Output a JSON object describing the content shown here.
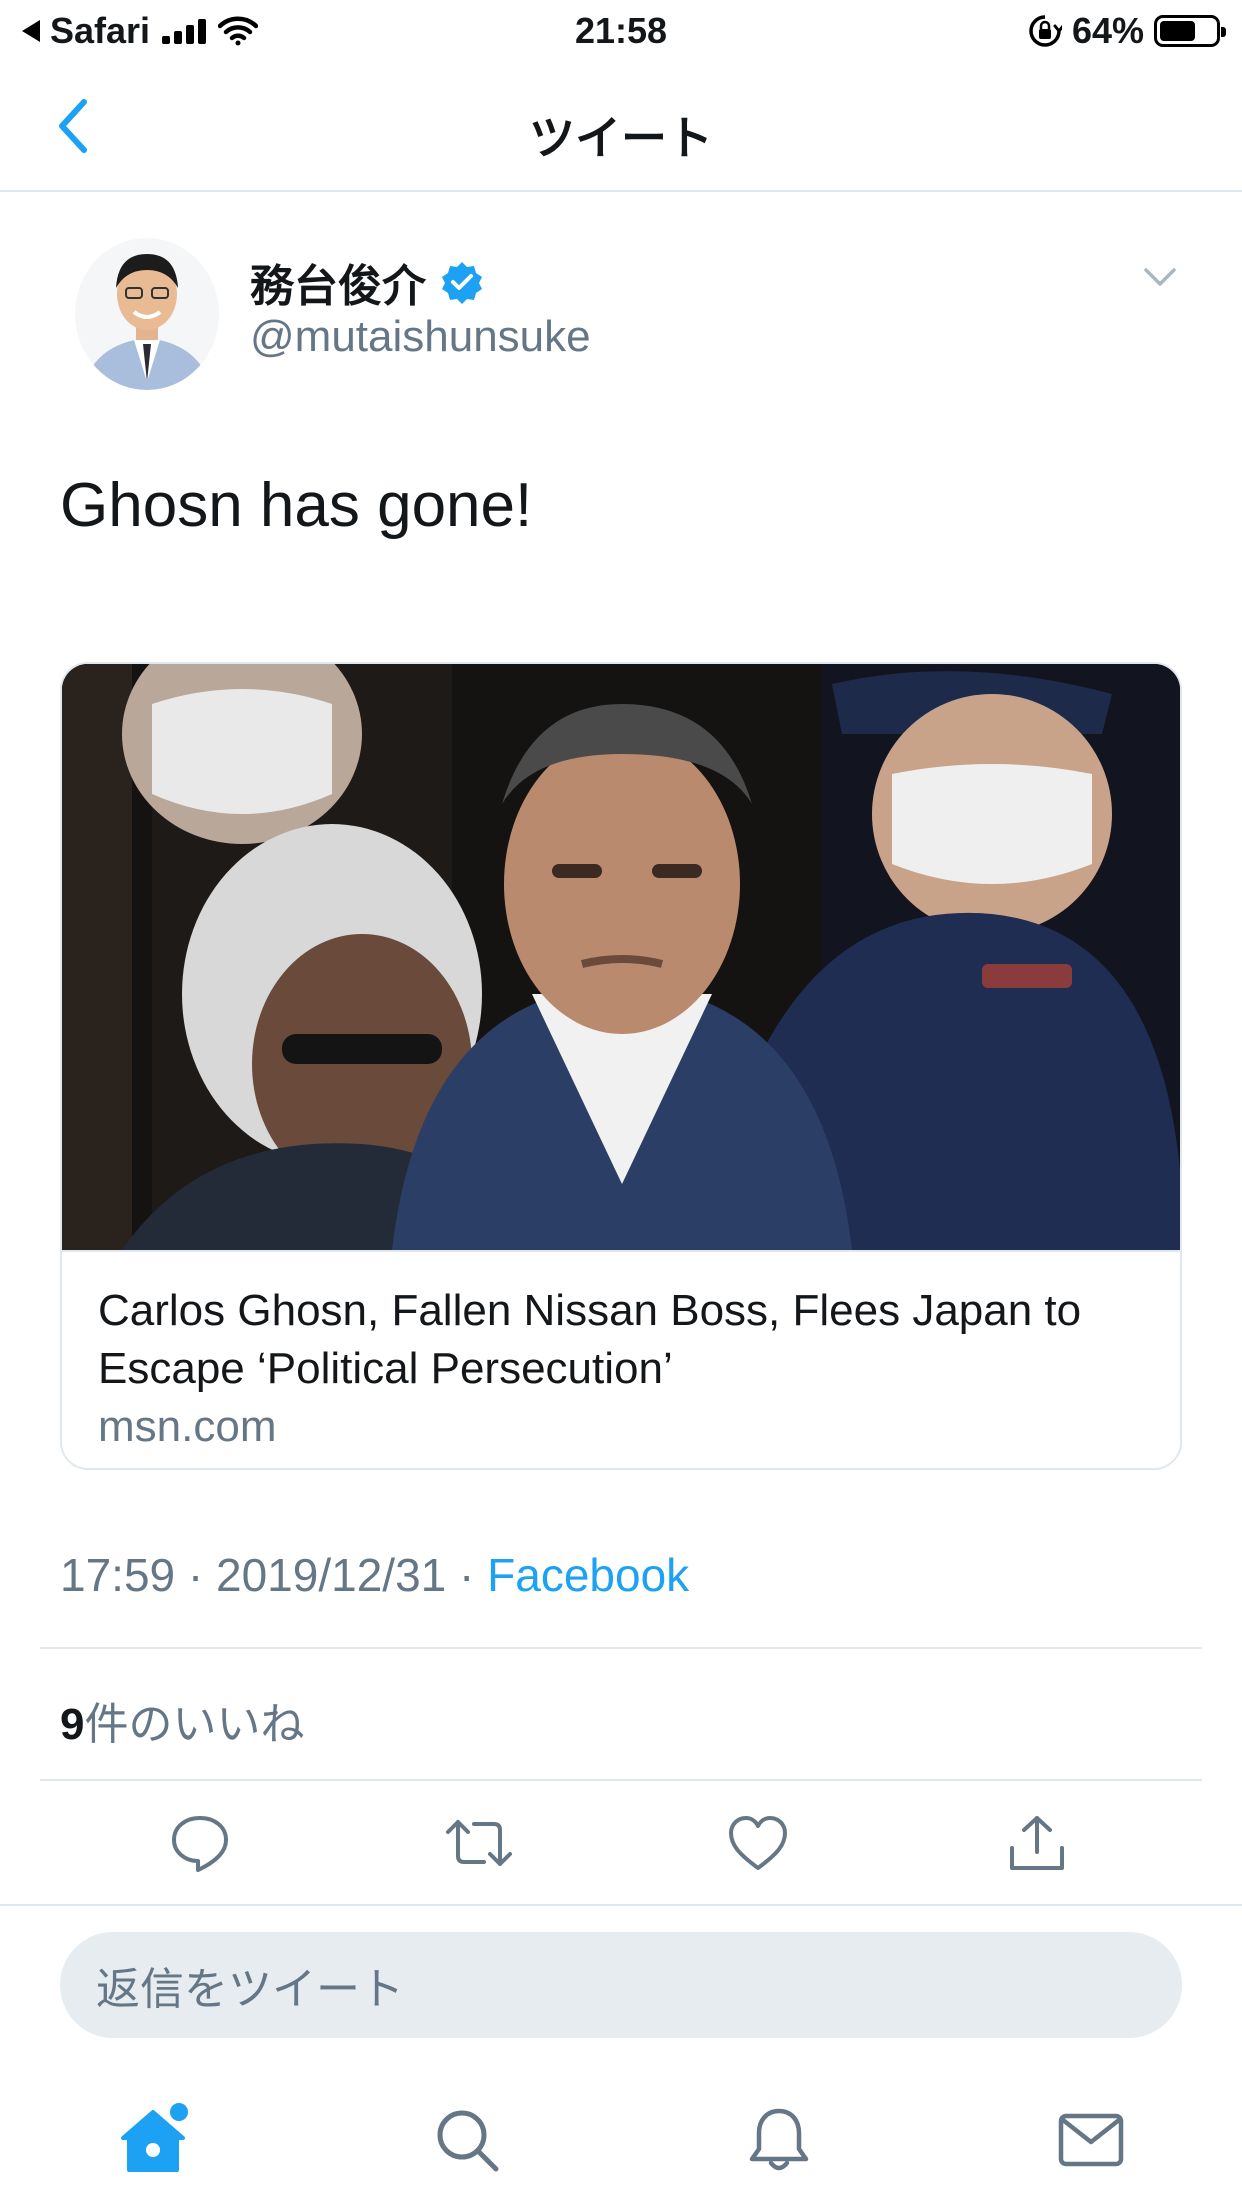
{
  "status_bar": {
    "back_app": "Safari",
    "time": "21:58",
    "battery_percent": "64%",
    "battery_level": 0.64
  },
  "nav": {
    "title": "ツイート"
  },
  "tweet": {
    "user_name": "務台俊介",
    "handle": "@mutaishunsuke",
    "verified": true,
    "text": "Ghosn has gone!",
    "card": {
      "title": "Carlos Ghosn, Fallen Nissan Boss, Flees Japan to Escape ‘Political Persecution’",
      "domain": "msn.com"
    },
    "time": "17:59",
    "date": "2019/12/31",
    "separator": "·",
    "source": "Facebook",
    "likes_count": "9",
    "likes_label": "件のいいね"
  },
  "reply": {
    "placeholder": "返信をツイート"
  },
  "colors": {
    "accent": "#1da1f2",
    "muted": "#657786",
    "text": "#14171a",
    "border": "#e1e8ed",
    "input_bg": "#e6ecf0"
  },
  "icons": {
    "actions": [
      "reply-icon",
      "retweet-icon",
      "like-icon",
      "share-icon"
    ],
    "tabs": [
      "home-icon",
      "search-icon",
      "notifications-icon",
      "messages-icon"
    ]
  }
}
